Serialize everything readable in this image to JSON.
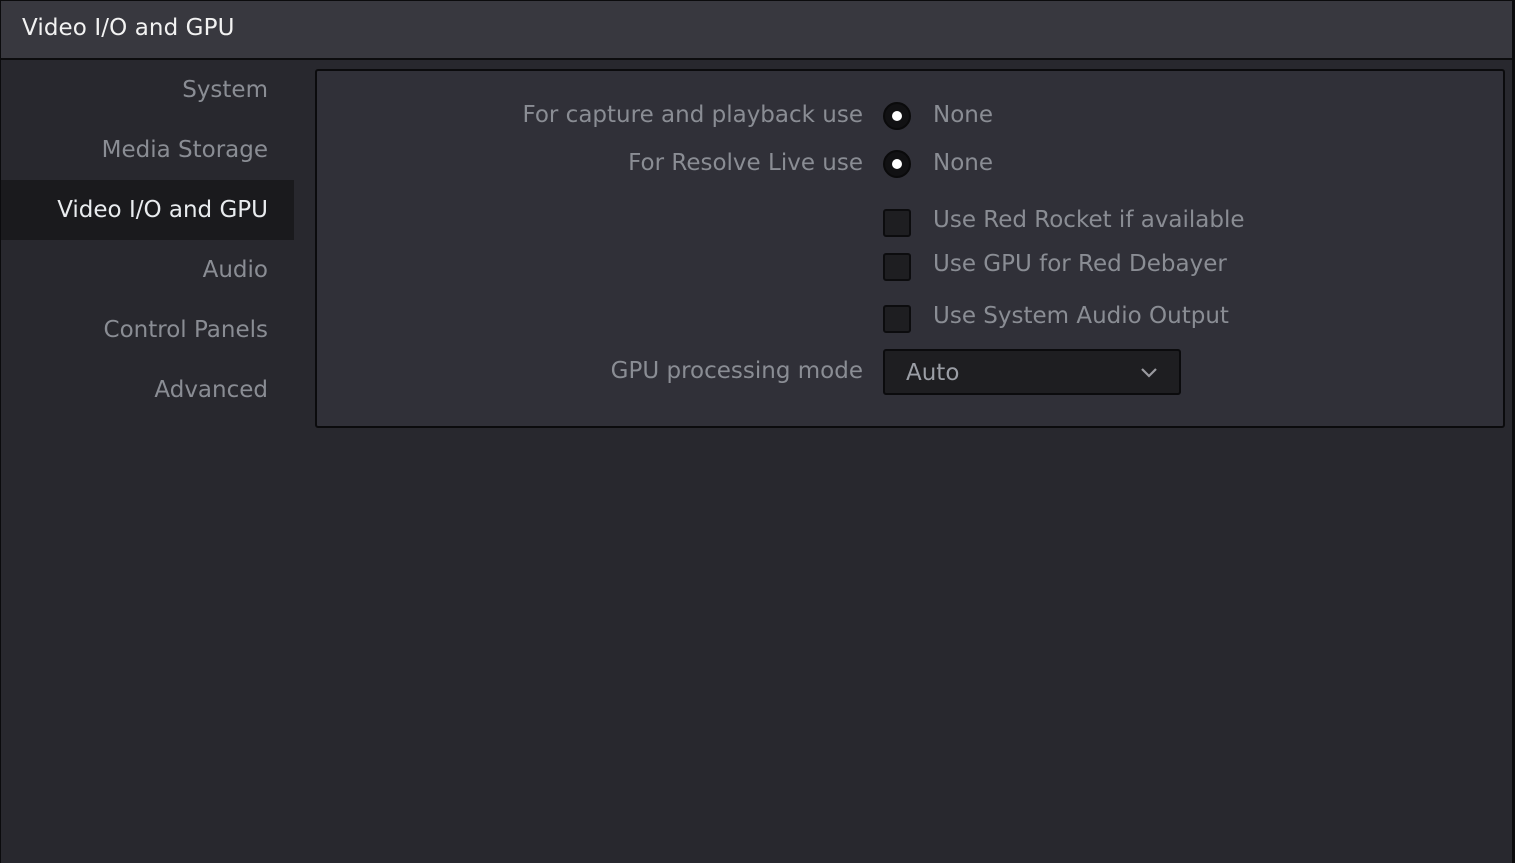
{
  "window": {
    "title": "Video I/O and GPU"
  },
  "sidebar": {
    "items": [
      {
        "label": "System",
        "active": false
      },
      {
        "label": "Media Storage",
        "active": false
      },
      {
        "label": "Video I/O and GPU",
        "active": true
      },
      {
        "label": "Audio",
        "active": false
      },
      {
        "label": "Control Panels",
        "active": false
      },
      {
        "label": "Advanced",
        "active": false
      }
    ]
  },
  "settings": {
    "capture_playback": {
      "label": "For capture and playback use",
      "selected": "None"
    },
    "resolve_live": {
      "label": "For Resolve Live use",
      "selected": "None"
    },
    "red_rocket": {
      "label": "Use Red Rocket if available",
      "checked": false
    },
    "gpu_red_debayer": {
      "label": "Use GPU for Red Debayer",
      "checked": false
    },
    "system_audio": {
      "label": "Use System Audio Output",
      "checked": false
    },
    "gpu_mode": {
      "label": "GPU processing mode",
      "value": "Auto",
      "icon": "chevron-down-icon"
    }
  }
}
